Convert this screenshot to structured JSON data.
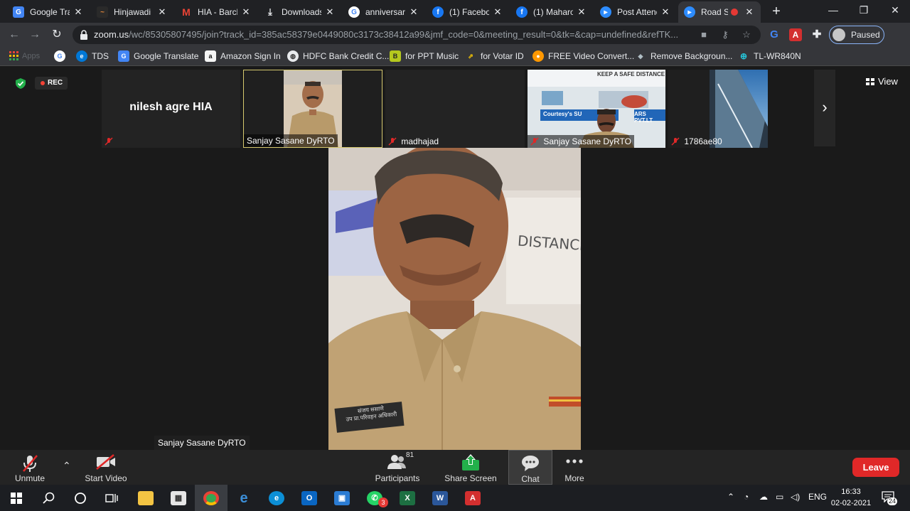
{
  "browser": {
    "tabs": [
      {
        "title": "Google Tra",
        "favicon": "google-translate-icon",
        "color": "#4285f4"
      },
      {
        "title": "Hinjawadi I",
        "favicon": "hinjawadi-icon",
        "color": "#d4702a"
      },
      {
        "title": "HIA - Barcla",
        "favicon": "gmail-icon",
        "color": "#ea4335"
      },
      {
        "title": "Downloads",
        "favicon": "download-icon",
        "color": "#e8eaed"
      },
      {
        "title": "anniversary",
        "favicon": "google-icon",
        "color": "#4285f4"
      },
      {
        "title": "(1) Faceboo",
        "favicon": "facebook-icon",
        "color": "#1877f2"
      },
      {
        "title": "(1) Maharo",
        "favicon": "facebook-icon",
        "color": "#1877f2"
      },
      {
        "title": "Post Attend",
        "favicon": "zoom-icon",
        "color": "#2d8cff"
      },
      {
        "title": "Road S",
        "favicon": "zoom-icon",
        "color": "#2d8cff"
      }
    ],
    "address": {
      "host": "zoom.us",
      "path": "/wc/85305807495/join?track_id=385ac58379e0449080c3173c38412a99&jmf_code=0&meeting_result=0&tk=&cap=undefined&refTK..."
    },
    "profile_status": "Paused",
    "bookmarks": [
      {
        "label": "Apps",
        "icon": "apps-grid-icon",
        "color": "#ea4335"
      },
      {
        "label": "",
        "icon": "google-icon",
        "color": "#4285f4"
      },
      {
        "label": "TDS",
        "icon": "edge-icon",
        "color": "#0078d7"
      },
      {
        "label": "Google Translate",
        "icon": "google-translate-icon",
        "color": "#4285f4"
      },
      {
        "label": "Amazon Sign In",
        "icon": "amazon-icon",
        "color": "#f5f5f5"
      },
      {
        "label": "HDFC Bank Credit C...",
        "icon": "globe-icon",
        "color": "#e8eaed"
      },
      {
        "label": "for PPT Music",
        "icon": "music-icon",
        "color": "#b5c81e"
      },
      {
        "label": "for Votar ID",
        "icon": "arrows-icon",
        "color": "#ffcc00"
      },
      {
        "label": "FREE Video Convert...",
        "icon": "video-converter-icon",
        "color": "#ff9800"
      },
      {
        "label": "Remove Backgroun...",
        "icon": "layers-icon",
        "color": "#b0bec5"
      },
      {
        "label": "TL-WR840N",
        "icon": "router-icon",
        "color": "#26c6da"
      }
    ]
  },
  "meeting": {
    "rec_label": "REC",
    "view_label": "View",
    "strip": [
      {
        "name": "nilesh agre HIA",
        "muted": true
      },
      {
        "name": "Sanjay Sasane DyRTO",
        "muted": false
      },
      {
        "name": "madhajad",
        "muted": true
      },
      {
        "name": "Sanjay Sasane DyRTO",
        "muted": true
      },
      {
        "name": "1786ae80",
        "muted": true
      }
    ],
    "active_speaker": "Sanjay Sasane DyRTO",
    "poster_text": "KEEP A SAFE DISTANCE",
    "poster_credit": "Courtesy's SU",
    "poster_credit2": "ARS PVT.LT",
    "wall_text": "DISTANCE",
    "badge_line1": "संजय ससाणे",
    "badge_line2": "उप प्रा.परिवहन अधिकारी"
  },
  "controls": {
    "unmute": "Unmute",
    "start_video": "Start Video",
    "participants": "Participants",
    "participants_count": "81",
    "share_screen": "Share Screen",
    "chat": "Chat",
    "more": "More",
    "leave": "Leave"
  },
  "taskbar": {
    "lang": "ENG",
    "time": "16:33",
    "date": "02-02-2021",
    "notifications": "24",
    "whatsapp_badge": "3"
  }
}
